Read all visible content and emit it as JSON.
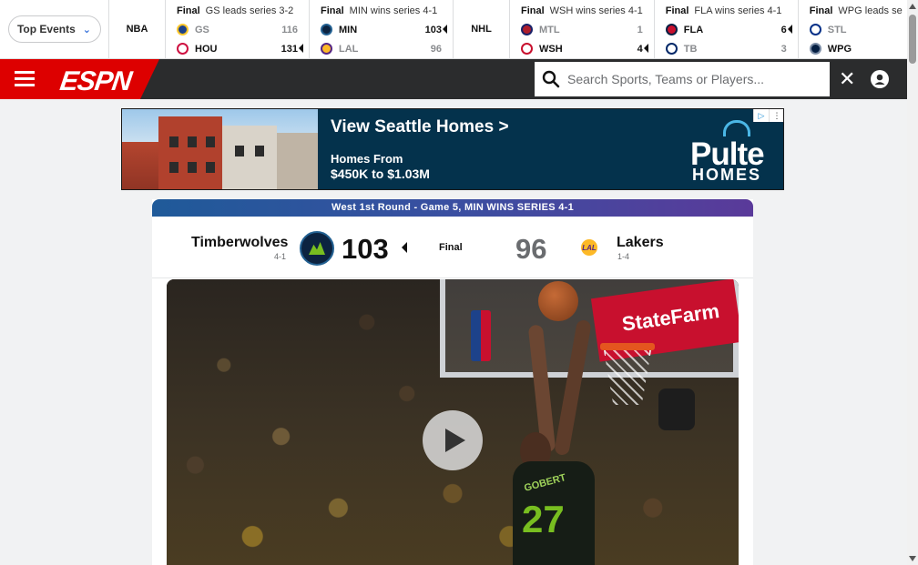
{
  "scorestrip": {
    "events_label": "Top Events",
    "sections": [
      {
        "league": "NBA",
        "games": [
          {
            "status": "Final",
            "note": "GS leads series 3-2",
            "teams": [
              {
                "abbr": "GS",
                "score": "116",
                "winner": false,
                "color": "#1d428a"
              },
              {
                "abbr": "HOU",
                "score": "131",
                "winner": true,
                "color": "#ce1141"
              }
            ]
          },
          {
            "status": "Final",
            "note": "MIN wins series 4-1",
            "teams": [
              {
                "abbr": "MIN",
                "score": "103",
                "winner": true,
                "color": "#0c2340"
              },
              {
                "abbr": "LAL",
                "score": "96",
                "winner": false,
                "color": "#fdb927"
              }
            ]
          }
        ]
      },
      {
        "league": "NHL",
        "games": [
          {
            "status": "Final",
            "note": "WSH wins series 4-1",
            "teams": [
              {
                "abbr": "MTL",
                "score": "1",
                "winner": false,
                "color": "#af1e2d"
              },
              {
                "abbr": "WSH",
                "score": "4",
                "winner": true,
                "color": "#c8102e"
              }
            ]
          },
          {
            "status": "Final",
            "note": "FLA wins series 4-1",
            "teams": [
              {
                "abbr": "FLA",
                "score": "6",
                "winner": true,
                "color": "#c8102e"
              },
              {
                "abbr": "TB",
                "score": "3",
                "winner": false,
                "color": "#002868"
              }
            ]
          },
          {
            "status": "Final",
            "note": "WPG leads se",
            "teams": [
              {
                "abbr": "STL",
                "score": "",
                "winner": false,
                "color": "#002f87"
              },
              {
                "abbr": "WPG",
                "score": "",
                "winner": true,
                "color": "#041e42"
              }
            ]
          }
        ]
      }
    ]
  },
  "nav": {
    "brand": "ESPN",
    "search_placeholder": "Search Sports, Teams or Players...",
    "close_glyph": "✕"
  },
  "ad": {
    "title": "View Seattle Homes >",
    "line1": "Homes From",
    "line2": "$450K to $1.03M",
    "brand": "Pulte",
    "brand2": "HOMES",
    "choices_icon": "▷",
    "choices_close": "⋮"
  },
  "game": {
    "banner": "West 1st Round - Game 5, MIN WINS SERIES 4-1",
    "status": "Final",
    "home": {
      "name": "Timberwolves",
      "record": "4-1",
      "score": "103"
    },
    "away": {
      "name": "Lakers",
      "record": "1-4",
      "score": "96"
    },
    "video": {
      "jersey_name": "GOBERT",
      "jersey_number": "27",
      "board_sponsor": "StateFarm"
    }
  },
  "colors": {
    "espn_red": "#dd0000",
    "nav_dark": "#2b2c2d",
    "ad_navy": "#04324c"
  }
}
